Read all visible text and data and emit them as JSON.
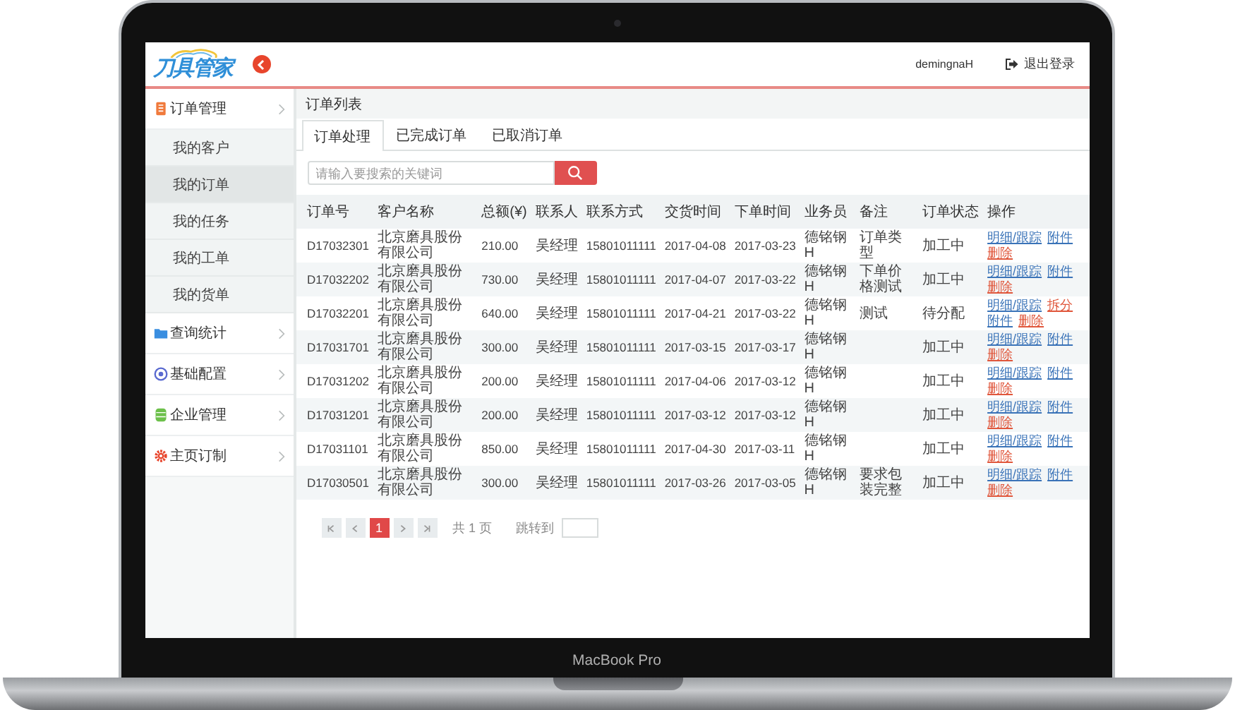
{
  "header": {
    "logo": "刀具管家",
    "username": "demingnaH",
    "logout": "退出登录"
  },
  "sidebar": {
    "groups": [
      {
        "label": "订单管理",
        "children": [
          {
            "label": "我的客户",
            "selected": false
          },
          {
            "label": "我的订单",
            "selected": true
          },
          {
            "label": "我的任务",
            "selected": false
          },
          {
            "label": "我的工单",
            "selected": false
          },
          {
            "label": "我的货单",
            "selected": false
          }
        ]
      },
      {
        "label": "查询统计"
      },
      {
        "label": "基础配置"
      },
      {
        "label": "企业管理"
      },
      {
        "label": "主页订制"
      }
    ]
  },
  "main": {
    "title": "订单列表",
    "tabs": [
      {
        "label": "订单处理",
        "selected": true
      },
      {
        "label": "已完成订单",
        "selected": false
      },
      {
        "label": "已取消订单",
        "selected": false
      }
    ],
    "search": {
      "placeholder": "请输入要搜索的关键词"
    },
    "table": {
      "columns": [
        "订单号",
        "客户名称",
        "总额(¥)",
        "联系人",
        "联系方式",
        "交货时间",
        "下单时间",
        "业务员",
        "备注",
        "订单状态",
        "操作"
      ],
      "rows": [
        {
          "cells": [
            "D17032301",
            "北京磨具股份有限公司",
            "210.00",
            "吴经理",
            "15801011111",
            "2017-04-08",
            "2017-03-23",
            "德铭钢H",
            "订单类型",
            "加工中"
          ],
          "actions": [
            {
              "label": "明细/跟踪",
              "color": "#3a73b8"
            },
            {
              "label": "附件",
              "color": "#3a73b8"
            },
            {
              "label": "删除",
              "color": "#e0573c"
            }
          ]
        },
        {
          "cells": [
            "D17032202",
            "北京磨具股份有限公司",
            "730.00",
            "吴经理",
            "15801011111",
            "2017-04-07",
            "2017-03-22",
            "德铭钢H",
            "下单价格测试",
            "加工中"
          ],
          "actions": [
            {
              "label": "明细/跟踪",
              "color": "#3a73b8"
            },
            {
              "label": "附件",
              "color": "#3a73b8"
            },
            {
              "label": "删除",
              "color": "#e0573c"
            }
          ]
        },
        {
          "cells": [
            "D17032201",
            "北京磨具股份有限公司",
            "640.00",
            "吴经理",
            "15801011111",
            "2017-04-21",
            "2017-03-22",
            "德铭钢H",
            "测试",
            "待分配"
          ],
          "actions": [
            {
              "label": "明细/跟踪",
              "color": "#3a73b8"
            },
            {
              "label": "拆分",
              "color": "#e0573c"
            },
            {
              "label": "附件",
              "color": "#3a73b8"
            },
            {
              "label": "删除",
              "color": "#e0573c"
            }
          ]
        },
        {
          "cells": [
            "D17031701",
            "北京磨具股份有限公司",
            "300.00",
            "吴经理",
            "15801011111",
            "2017-03-15",
            "2017-03-17",
            "德铭钢H",
            "",
            "加工中"
          ],
          "actions": [
            {
              "label": "明细/跟踪",
              "color": "#3a73b8"
            },
            {
              "label": "附件",
              "color": "#3a73b8"
            },
            {
              "label": "删除",
              "color": "#e0573c"
            }
          ]
        },
        {
          "cells": [
            "D17031202",
            "北京磨具股份有限公司",
            "200.00",
            "吴经理",
            "15801011111",
            "2017-04-06",
            "2017-03-12",
            "德铭钢H",
            "",
            "加工中"
          ],
          "actions": [
            {
              "label": "明细/跟踪",
              "color": "#3a73b8"
            },
            {
              "label": "附件",
              "color": "#3a73b8"
            },
            {
              "label": "删除",
              "color": "#e0573c"
            }
          ]
        },
        {
          "cells": [
            "D17031201",
            "北京磨具股份有限公司",
            "200.00",
            "吴经理",
            "15801011111",
            "2017-03-12",
            "2017-03-12",
            "德铭钢H",
            "",
            "加工中"
          ],
          "actions": [
            {
              "label": "明细/跟踪",
              "color": "#3a73b8"
            },
            {
              "label": "附件",
              "color": "#3a73b8"
            },
            {
              "label": "删除",
              "color": "#e0573c"
            }
          ]
        },
        {
          "cells": [
            "D17031101",
            "北京磨具股份有限公司",
            "850.00",
            "吴经理",
            "15801011111",
            "2017-04-30",
            "2017-03-11",
            "德铭钢H",
            "",
            "加工中"
          ],
          "actions": [
            {
              "label": "明细/跟踪",
              "color": "#3a73b8"
            },
            {
              "label": "附件",
              "color": "#3a73b8"
            },
            {
              "label": "删除",
              "color": "#e0573c"
            }
          ]
        },
        {
          "cells": [
            "D17030501",
            "北京磨具股份有限公司",
            "300.00",
            "吴经理",
            "15801011111",
            "2017-03-26",
            "2017-03-05",
            "德铭钢H",
            "要求包装完整",
            "加工中"
          ],
          "actions": [
            {
              "label": "明细/跟踪",
              "color": "#3a73b8"
            },
            {
              "label": "附件",
              "color": "#3a73b8"
            },
            {
              "label": "删除",
              "color": "#e0573c"
            }
          ]
        }
      ]
    },
    "pagination": {
      "pages": [
        {
          "label": "1",
          "selected": true
        }
      ],
      "total": "共 1 页",
      "jump_label": "跳转到"
    }
  },
  "device": {
    "label": "MacBook Pro"
  }
}
